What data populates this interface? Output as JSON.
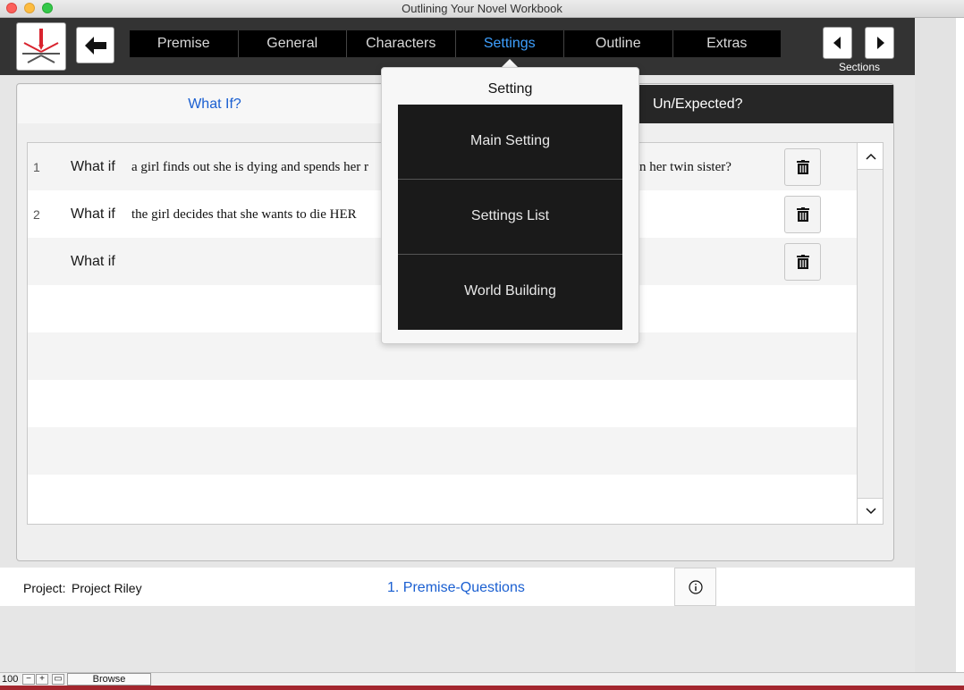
{
  "window": {
    "title": "Outlining Your Novel Workbook"
  },
  "nav": {
    "tabs": [
      "Premise",
      "General",
      "Characters",
      "Settings",
      "Outline",
      "Extras"
    ],
    "active_tab": "Settings",
    "sections_label": "Sections"
  },
  "subtabs": {
    "left": "What If?",
    "right": "Un/Expected?"
  },
  "rows": [
    {
      "num": "1",
      "label": "What if",
      "text": "a girl finds out she is dying and spends her r",
      "text_tail": "n her twin sister?"
    },
    {
      "num": "2",
      "label": "What if",
      "text": "the girl decides that she wants to die HER",
      "text_tail": ""
    },
    {
      "num": "",
      "label": "What if",
      "text": "",
      "text_tail": ""
    }
  ],
  "popover": {
    "title": "Setting",
    "items": [
      "Main Setting",
      "Settings List",
      "World Building"
    ]
  },
  "footer": {
    "project_label": "Project:",
    "project_name": "Project Riley",
    "link": "1. Premise-Questions"
  },
  "statusbar": {
    "zoom": "100",
    "mode": "Browse"
  },
  "colors": {
    "accent": "#3ea0ff",
    "link": "#1a5fd1",
    "topbar": "#333333",
    "logo_red": "#d9232e"
  },
  "icons": [
    "logo-icon",
    "back-arrow-icon",
    "chevron-left-icon",
    "chevron-right-icon",
    "trash-icon",
    "chevron-up-icon",
    "chevron-down-icon",
    "info-icon"
  ]
}
